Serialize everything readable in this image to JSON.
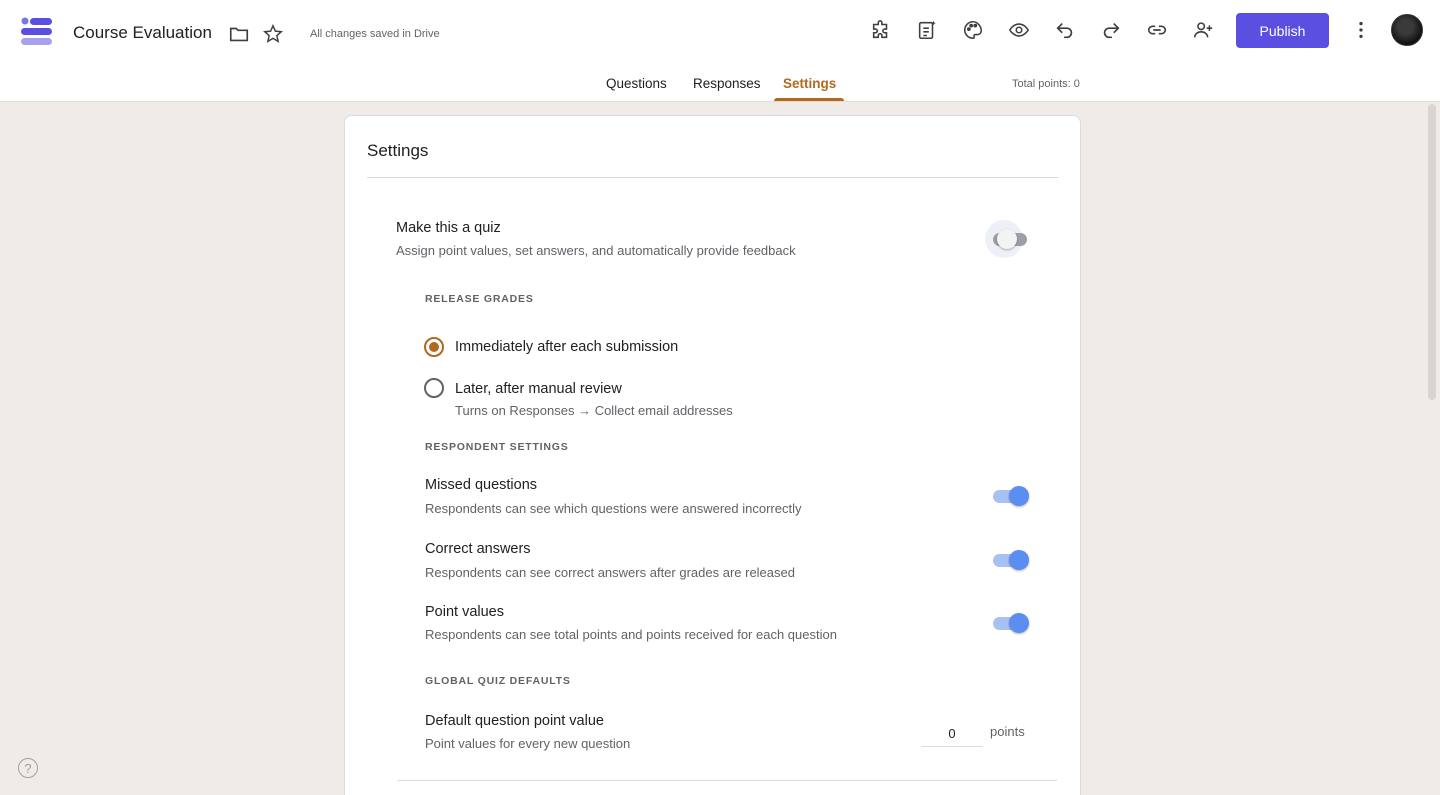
{
  "header": {
    "title": "Course Evaluation",
    "saved_status": "All changes saved in Drive",
    "publish_label": "Publish",
    "icons": [
      "folder-icon",
      "star-icon",
      "addons-icon",
      "ai-form-icon",
      "palette-icon",
      "preview-icon",
      "undo-icon",
      "redo-icon",
      "link-icon",
      "add-collaborator-icon",
      "more-vert-icon"
    ]
  },
  "tabs": [
    {
      "label": "Questions",
      "active": false
    },
    {
      "label": "Responses",
      "active": false
    },
    {
      "label": "Settings",
      "active": true
    }
  ],
  "total_points": "Total points: 0",
  "settings": {
    "title": "Settings",
    "quiz": {
      "title": "Make this a quiz",
      "subtitle": "Assign point values, set answers, and automatically provide feedback",
      "enabled": false
    },
    "release_grades": {
      "label": "RELEASE GRADES",
      "options": [
        {
          "label": "Immediately after each submission",
          "checked": true
        },
        {
          "label": "Later, after manual review",
          "subtitle": "Turns on Responses → Collect email addresses",
          "checked": false
        }
      ]
    },
    "respondent_settings": {
      "label": "RESPONDENT SETTINGS",
      "items": [
        {
          "title": "Missed questions",
          "subtitle": "Respondents can see which questions were answered incorrectly",
          "enabled": true
        },
        {
          "title": "Correct answers",
          "subtitle": "Respondents can see correct answers after grades are released",
          "enabled": true
        },
        {
          "title": "Point values",
          "subtitle": "Respondents can see total points and points received for each question",
          "enabled": true
        }
      ]
    },
    "global_defaults": {
      "label": "GLOBAL QUIZ DEFAULTS",
      "title": "Default question point value",
      "subtitle": "Point values for every new question",
      "value": "0",
      "unit": "points"
    }
  },
  "colors": {
    "accent": "#b06a1f",
    "publish": "#5a4fe0",
    "toggle_on": "#5b8ef0",
    "background": "#f1ebe7"
  },
  "help_glyph": "?"
}
